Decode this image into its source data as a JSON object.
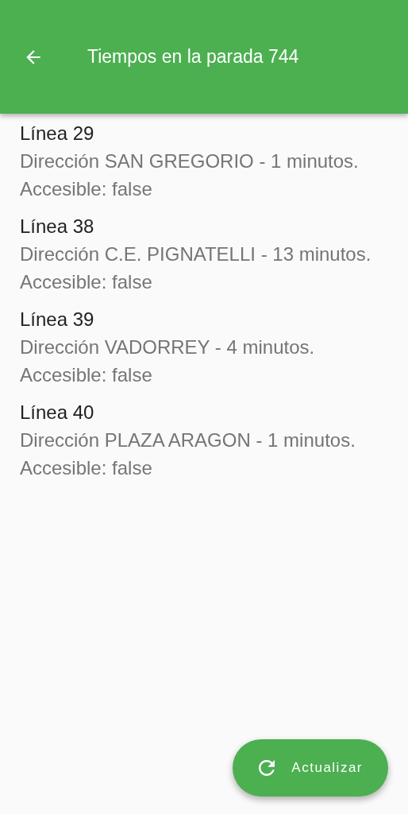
{
  "app_bar": {
    "title": "Tiempos en la parada 744"
  },
  "arrivals": [
    {
      "line": "Línea 29",
      "detail": "Dirección SAN GREGORIO - 1 minutos. Accesible: false"
    },
    {
      "line": "Línea 38",
      "detail": "Dirección C.E. PIGNATELLI - 13 minutos. Accesible: false"
    },
    {
      "line": "Línea 39",
      "detail": "Dirección VADORREY - 4 minutos. Accesible: false"
    },
    {
      "line": "Línea 40",
      "detail": "Dirección PLAZA ARAGON - 1 minutos. Accesible: false"
    }
  ],
  "refresh_button": {
    "label": "Actualizar"
  }
}
